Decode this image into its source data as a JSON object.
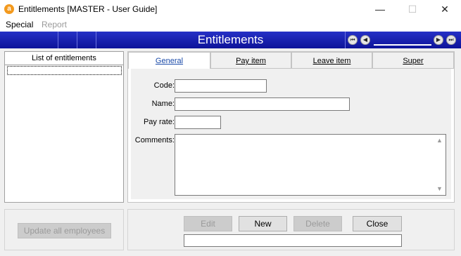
{
  "window": {
    "title": "Entitlements [MASTER - User Guide]",
    "logo_letter": "a",
    "min_glyph": "—",
    "max_glyph": "☐",
    "close_glyph": "✕"
  },
  "menu": {
    "special": "Special",
    "report": "Report"
  },
  "header": {
    "title": "Entitlements",
    "nav": {
      "first": "⏮",
      "prev": "◀",
      "next": "▶",
      "last": "⏭"
    }
  },
  "list": {
    "header": "List of entitlements"
  },
  "tabs": [
    {
      "label": "General"
    },
    {
      "label": "Pay item"
    },
    {
      "label": "Leave item"
    },
    {
      "label": "Super"
    }
  ],
  "form": {
    "code_label": "Code:",
    "name_label": "Name:",
    "payrate_label": "Pay rate:",
    "comments_label": "Comments:",
    "code_value": "",
    "name_value": "",
    "payrate_value": "",
    "comments_value": "",
    "scroll_up": "▲",
    "scroll_down": "▼"
  },
  "buttons": {
    "update_all": "Update all employees",
    "edit": "Edit",
    "new": "New",
    "delete": "Delete",
    "close": "Close"
  },
  "status": ""
}
